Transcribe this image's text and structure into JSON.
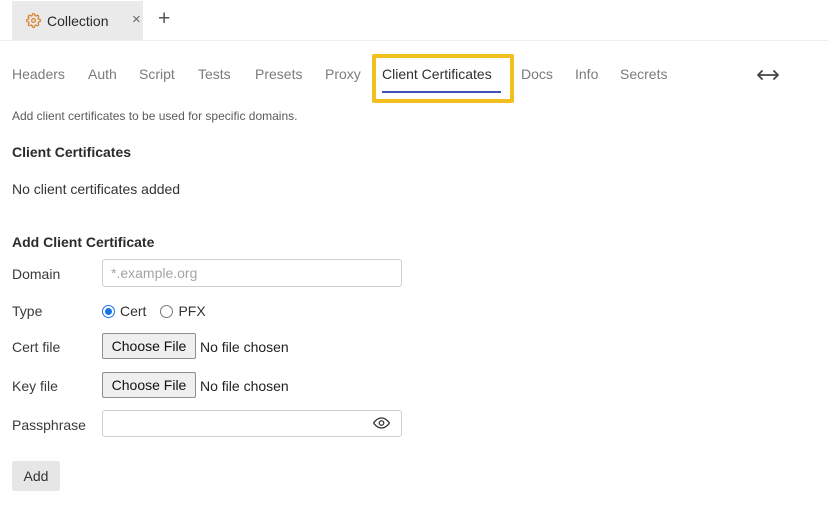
{
  "tabbar": {
    "tab": {
      "icon": "gear-icon",
      "title": "Collection",
      "close_icon": "close-icon",
      "close_glyph": "×"
    },
    "new_tab_glyph": "+",
    "new_tab_icon": "plus-icon"
  },
  "settings_tabs": {
    "items": [
      {
        "label": "Headers"
      },
      {
        "label": "Auth"
      },
      {
        "label": "Script"
      },
      {
        "label": "Tests"
      },
      {
        "label": "Presets"
      },
      {
        "label": "Proxy"
      },
      {
        "label": "Client Certificates",
        "active": true
      },
      {
        "label": "Docs"
      },
      {
        "label": "Info"
      },
      {
        "label": "Secrets"
      }
    ],
    "expand_icon": "expand-horizontal-icon",
    "active_color": "#3f51b5",
    "highlight_color": "#f2c01e"
  },
  "description": "Add client certificates to be used for specific domains.",
  "certificates": {
    "title": "Client Certificates",
    "empty_message": "No client certificates added"
  },
  "add_form": {
    "title": "Add Client Certificate",
    "domain": {
      "label": "Domain",
      "placeholder": "*.example.org",
      "value": ""
    },
    "type": {
      "label": "Type",
      "options": [
        {
          "label": "Cert",
          "checked": true
        },
        {
          "label": "PFX",
          "checked": false
        }
      ]
    },
    "cert_file": {
      "label": "Cert file",
      "button": "Choose File",
      "status": "No file chosen"
    },
    "key_file": {
      "label": "Key file",
      "button": "Choose File",
      "status": "No file chosen"
    },
    "passphrase": {
      "label": "Passphrase",
      "value": "",
      "toggle_icon": "eye-icon"
    },
    "submit_label": "Add"
  }
}
